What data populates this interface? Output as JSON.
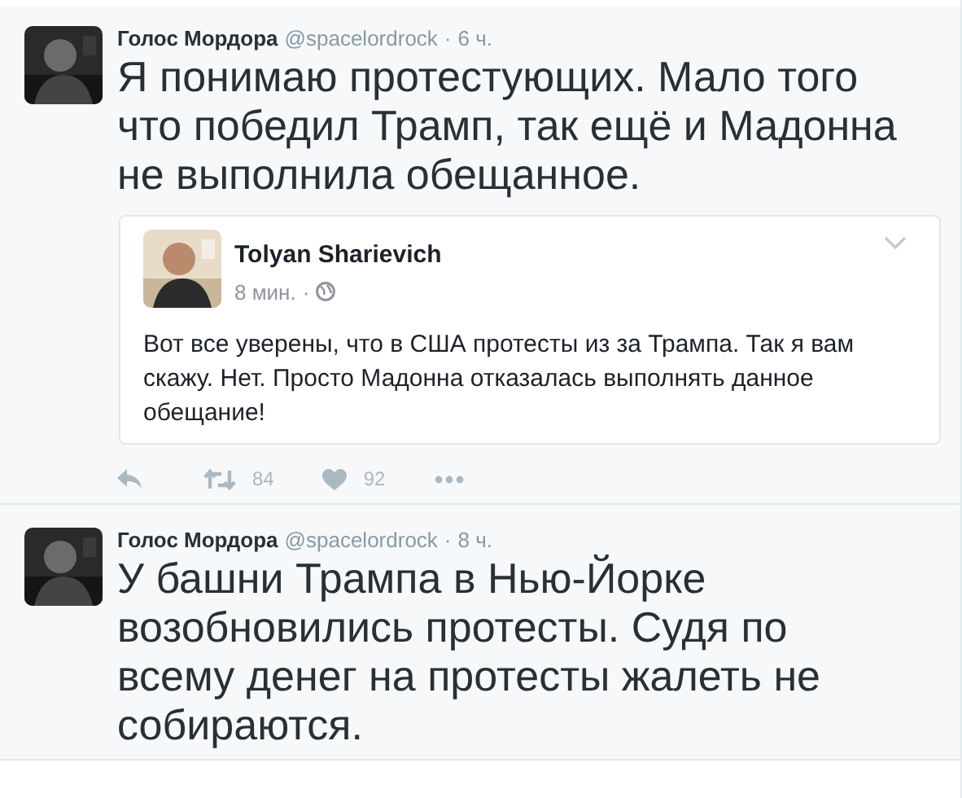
{
  "tweets": [
    {
      "author": "Голос Мордора",
      "handle": "@spacelordrock",
      "separator": "·",
      "time": "6 ч.",
      "text": "Я понимаю протестующих. Мало того что победил Трамп, так ещё и Мадонна не выполнила обещанное.",
      "quoted": {
        "author": "Tolyan Sharievich",
        "time": "8 мин.",
        "separator": "·",
        "text": "Вот все уверены, что в США протесты из за Трампа. Так я вам скажу. Нет. Просто Мадонна отказалась выполнять данное обещание!"
      },
      "actions": [
        {
          "kind": "reply"
        },
        {
          "kind": "retweet",
          "count": "84"
        },
        {
          "kind": "like",
          "count": "92"
        },
        {
          "kind": "more"
        }
      ]
    },
    {
      "author": "Голос Мордора",
      "handle": "@spacelordrock",
      "separator": "·",
      "time": "8 ч.",
      "text": "У башни Трампа в Нью-Йорке возобновились протесты. Судя по всему денег на протесты жалеть не собираются."
    }
  ]
}
